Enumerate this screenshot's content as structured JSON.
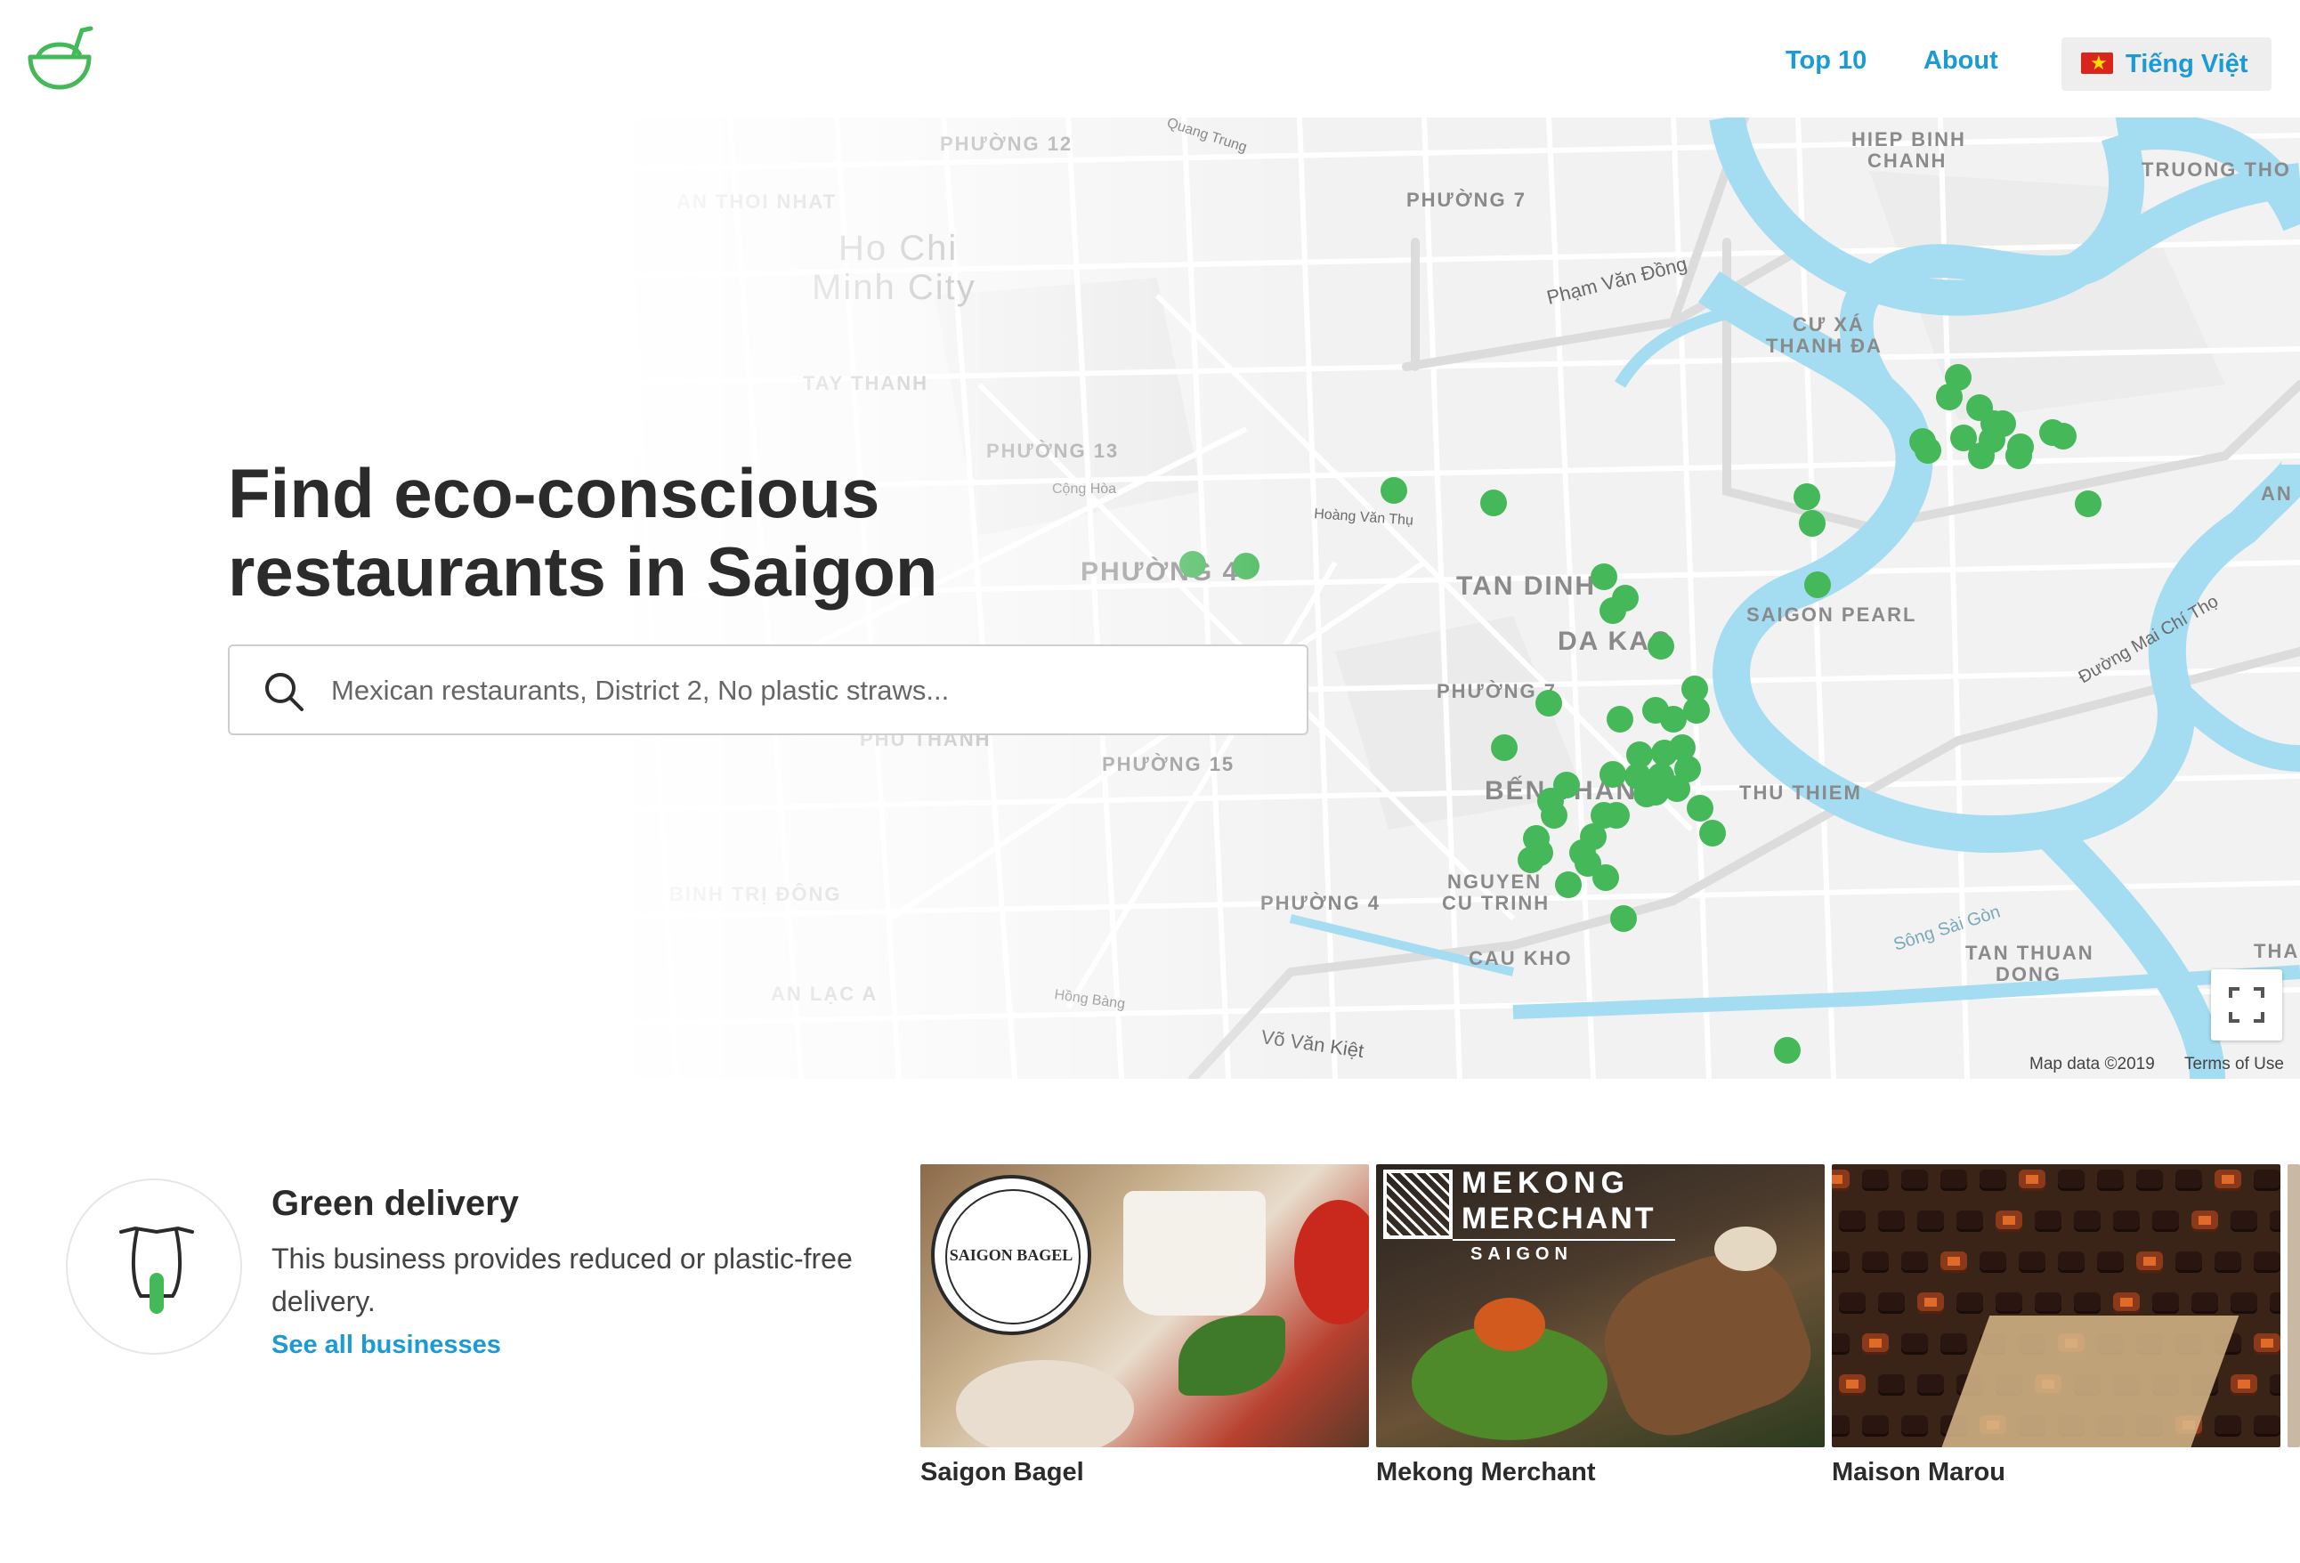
{
  "header": {
    "logo_icon": "coconut-bowl-icon",
    "nav": {
      "top10": "Top 10",
      "about": "About"
    },
    "language": {
      "flag_icon": "vietnam-flag-icon",
      "label": "Tiếng Việt"
    }
  },
  "hero": {
    "title": "Find eco-conscious restaurants in Saigon",
    "search": {
      "placeholder": "Mexican restaurants, District 2, No plastic straws...",
      "icon": "search-icon"
    }
  },
  "map": {
    "labels": {
      "phuong12": "PHƯỜNG 12",
      "anthoinhat": "AN THOI NHAT",
      "hcmc1": "Ho Chi",
      "hcmc2": "Minh City",
      "taythanh": "TAY THANH",
      "phuong13": "PHƯỜNG 13",
      "phuong4a": "PHƯỜNG 4",
      "phuthanh": "PHU THANH",
      "phuong15": "PHƯỜNG 15",
      "binhtridong": "BINH TRỊ ĐÔNG",
      "anlaca": "AN LẠC A",
      "phuong7a": "PHƯỜNG 7",
      "tandinh": "TAN DINH",
      "dakao": "DA KAO",
      "phuong7b": "PHƯỜNG 7",
      "benthanh": "BẾN THÀNH",
      "phuong4b": "PHƯỜNG 4",
      "nguyencutrinh1": "NGUYEN",
      "nguyencutrinh2": "CU TRINH",
      "caukho": "CAU KHO",
      "hiepbinhchanh1": "HIEP BINH",
      "hiepbinhchanh2": "CHANH",
      "cuxathanhda1": "CƯ XÁ",
      "cuxathanhda2": "THANH ĐA",
      "saigonpearl": "SAIGON PEARL",
      "thuthiem": "THU THIEM",
      "tanthuandong1": "TAN THUAN",
      "tanthuandong2": "DONG",
      "truongtho": "TRUONG THO",
      "an": "AN",
      "thanh": "THANH",
      "phamvandong": "Phạm Văn Đồng",
      "vovankiet": "Võ Văn Kiệt",
      "songsaigon": "Sông Sài Gòn",
      "mailichitho": "Đường Mai Chí Thọ",
      "hoangvanthu": "Hoàng Văn Thụ",
      "conghoa": "Cộng Hòa",
      "hongbang": "Hồng Bàng",
      "quangtrung": "Quang Trung"
    },
    "markers_count": 60,
    "attribution": {
      "data": "Map data ©2019",
      "terms": "Terms of Use"
    },
    "fullscreen_icon": "fullscreen-icon",
    "marker_color": "#45b85a",
    "water_color": "#a4dcf2"
  },
  "feature": {
    "icon": "scooter-icon",
    "title": "Green delivery",
    "description": "This business provides reduced or plastic-free delivery.",
    "link": "See all businesses"
  },
  "cards": [
    {
      "name": "Saigon Bagel",
      "logo_text": "SAIGON BAGEL"
    },
    {
      "name": "Mekong Merchant",
      "logo_line1": "MEKONG",
      "logo_line2": "MERCHANT",
      "logo_line3": "SAIGON"
    },
    {
      "name": "Maison Marou"
    }
  ],
  "colors": {
    "accent": "#1a9ad6",
    "brand_green": "#45b85a",
    "text": "#2b2b2b"
  }
}
